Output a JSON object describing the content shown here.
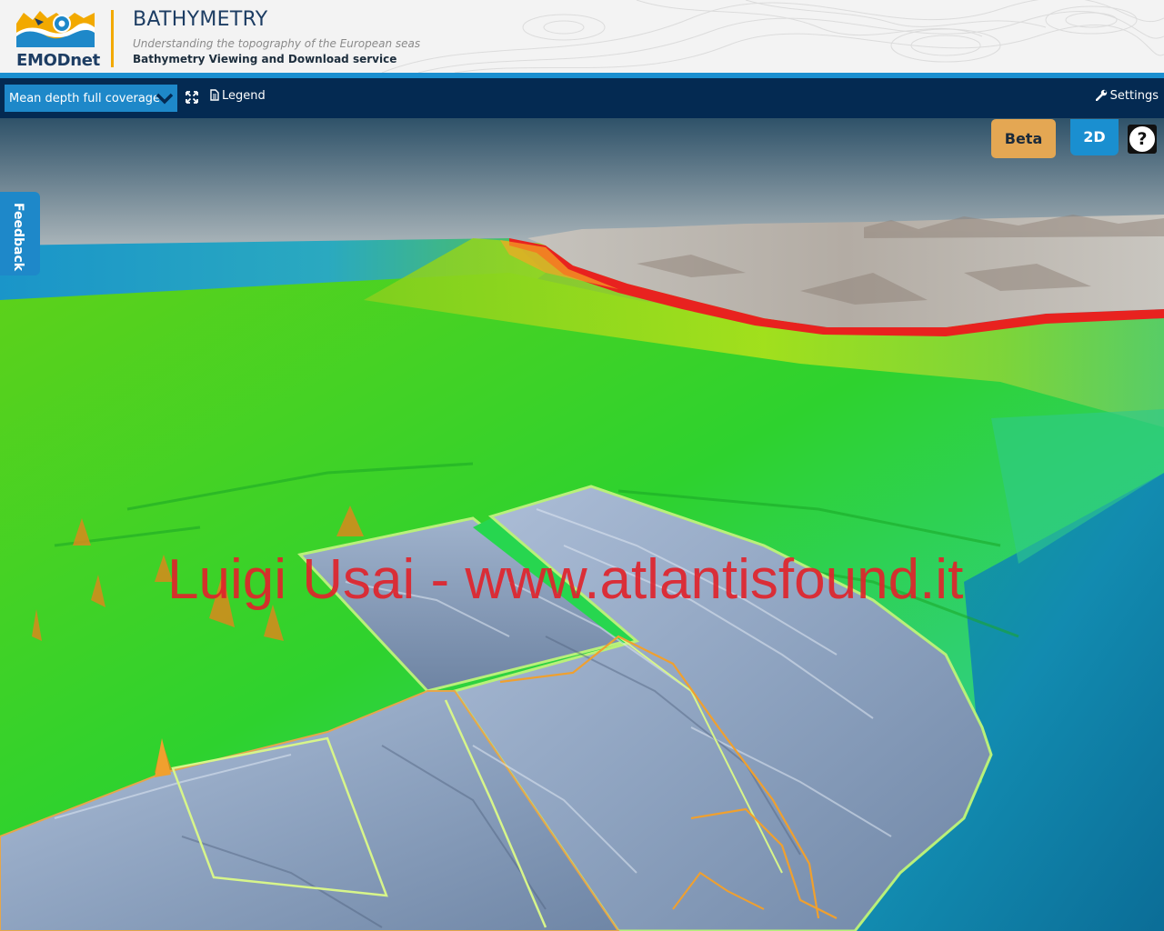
{
  "header": {
    "logo_text": "EMODnet",
    "title": "BATHYMETRY",
    "subtitle": "Understanding the topography of the European seas",
    "service": "Bathymetry Viewing and Download service"
  },
  "toolbar": {
    "layer_select_value": "Mean depth full coverage",
    "fullscreen_icon": "expand-arrows-icon",
    "legend_label": "Legend",
    "settings_label": "Settings"
  },
  "map": {
    "beta_label": "Beta",
    "view_mode_label": "2D",
    "help_label": "?",
    "feedback_label": "Feedback",
    "watermark": "Luigi Usai - www.atlantisfound.it"
  },
  "colors": {
    "header_bg": "#f3f3f3",
    "toolbar_bg": "#042a52",
    "accent_blue": "#1e88c9",
    "beta_orange": "#e4a753",
    "divider_gold": "#f2a900",
    "watermark_red": "#e0242c"
  }
}
